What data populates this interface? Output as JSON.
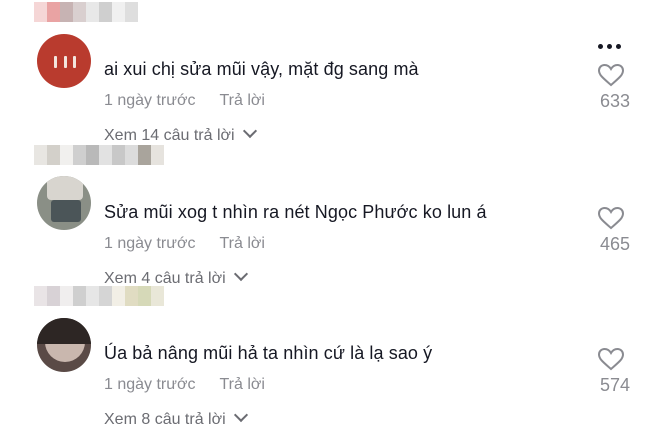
{
  "comments": [
    {
      "text": "ai xui chị sửa mũi vậy, mặt đg sang mà",
      "date": "1 ngày trước",
      "reply_label": "Trả lời",
      "view_replies": "Xem 14 câu trả lời",
      "likes": "633",
      "username_blocks": [
        "#f5d6d6",
        "#e9a3a3",
        "#c7b3b3",
        "#d9cfcf",
        "#e8e8e8",
        "#cfcfcf",
        "#f0f0f0",
        "#dedede"
      ]
    },
    {
      "text": "Sửa mũi xog t nhìn ra nét Ngọc Phước ko lun á",
      "date": "1 ngày trước",
      "reply_label": "Trả lời",
      "view_replies": "Xem 4 câu trả lời",
      "likes": "465",
      "username_blocks": [
        "#e8e6e2",
        "#d3d0ca",
        "#f1f0ee",
        "#cfcfcf",
        "#b9b9b9",
        "#e2e2e2",
        "#c8c8c8",
        "#dcdcdc",
        "#a9a49c",
        "#e6e3de"
      ]
    },
    {
      "text": "Úa bả nâng mũi hả ta nhìn cứ là lạ sao ý",
      "date": "1 ngày trước",
      "reply_label": "Trả lời",
      "view_replies": "Xem 8 câu trả lời",
      "likes": "574",
      "username_blocks": [
        "#e9e4e6",
        "#d8d2d6",
        "#f0eeee",
        "#cfcfcf",
        "#e6e6e6",
        "#d5d5d5",
        "#f2efe6",
        "#e0dcc2",
        "#d6d9b8",
        "#e9e7d8"
      ]
    }
  ],
  "colors": {
    "text": "#161823",
    "muted": "#8a8b91",
    "avatar_1": "#b93b2e"
  },
  "icons": [
    "more-dots-icon",
    "heart-outline-icon",
    "chevron-down-icon"
  ]
}
